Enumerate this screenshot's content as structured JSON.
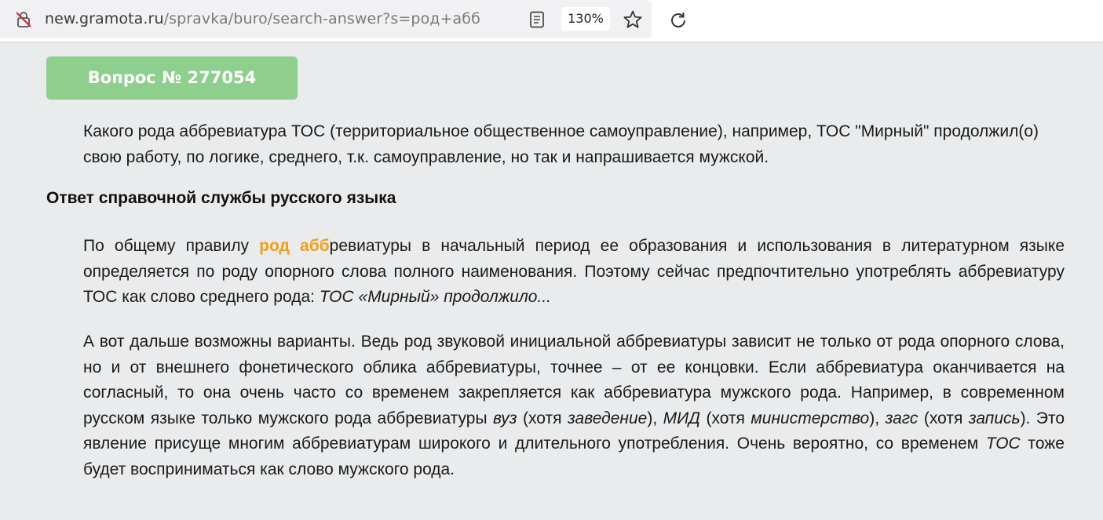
{
  "browser": {
    "url_host": "new.gramota.ru",
    "url_path": "/spravka/buro/search-answer?s=род+абб",
    "zoom": "130%",
    "icons": [
      "insecure-lock-icon",
      "reader-view-icon",
      "bookmark-star-icon",
      "reload-icon"
    ]
  },
  "question": {
    "badge": "Вопрос № 277054",
    "text": "Какого рода аббревиатура ТОС (территориальное общественное самоуправление), например, ТОС \"Мирный\" продолжил(о) свою работу, по логике, среднего, т.к. самоуправление, но так и напрашивается мужской."
  },
  "answer": {
    "heading": "Ответ справочной службы русского языка",
    "p1": {
      "t1": "По общему правилу ",
      "highlight": "род абб",
      "t2": "ревиатуры в начальный период ее образования и использования в литературном языке определяется по роду опорного слова полного наименования. Поэтому сейчас предпочтительно употреблять аббревиатуру ТОС как слово среднего рода: ",
      "example": "ТОС «Мирный» продолжило..."
    },
    "p2": {
      "t1": "А вот дальше возможны варианты. Ведь род звуковой инициальной аббревиатуры зависит не только от рода опорного слова, но и от внешнего фонетического облика аббревиатуры, точнее – от ее концовки. Если аббревиатура оканчивается на согласный, то она очень часто со временем закрепляется как аббревиатура мужского рода. Например, в современном русском языке только мужского рода аббревиатуры ",
      "e1": "вуз",
      "t2": " (хотя ",
      "e2": "заведение",
      "t3": "), ",
      "e3": "МИД",
      "t4": " (хотя ",
      "e4": "министерство",
      "t5": "), ",
      "e5": "загс",
      "t6": " (хотя ",
      "e6": "запись",
      "t7": "). Это явление присуще многим аббревиатурам широкого и длительного употребления. Очень вероятно, со временем ",
      "e7": "ТОС",
      "t8": " тоже будет восприниматься как слово мужского рода."
    }
  },
  "colors": {
    "badge_bg": "#8ecf8e",
    "highlight": "#f0a018",
    "page_bg": "#e9ebed"
  }
}
